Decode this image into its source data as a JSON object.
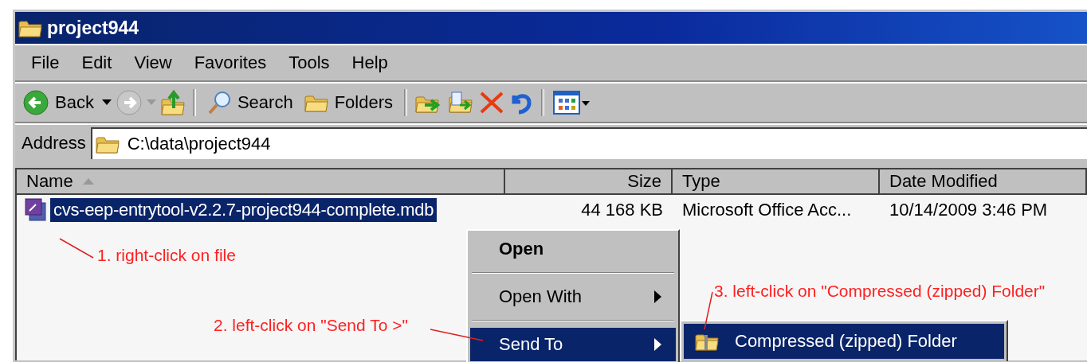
{
  "window": {
    "title": "project944"
  },
  "menu_bar": [
    "File",
    "Edit",
    "View",
    "Favorites",
    "Tools",
    "Help"
  ],
  "toolbar": {
    "back": "Back",
    "search": "Search",
    "folders": "Folders"
  },
  "address": {
    "label": "Address",
    "value": "C:\\data\\project944"
  },
  "columns": [
    {
      "label": "Name",
      "sorted": true
    },
    {
      "label": "Size",
      "sorted": false
    },
    {
      "label": "Type",
      "sorted": false
    },
    {
      "label": "Date Modified",
      "sorted": false
    }
  ],
  "files": [
    {
      "name": "cvs-eep-entrytool-v2.2.7-project944-complete.mdb",
      "size": "44 168 KB",
      "type": "Microsoft Office Acc...",
      "modified": "10/14/2009 3:46 PM",
      "selected": true
    }
  ],
  "context_menu": [
    {
      "label": "Open",
      "kind": "default",
      "selected": false
    },
    {
      "label": "Open With",
      "kind": "submenu",
      "selected": false
    },
    {
      "label": "Send To",
      "kind": "submenu",
      "selected": true
    }
  ],
  "submenu": [
    {
      "label": "Compressed (zipped) Folder",
      "selected": true
    }
  ],
  "annotations": [
    "1. right-click on file",
    "2. left-click on \"Send To >\"",
    "3. left-click on \"Compressed (zipped) Folder\""
  ]
}
